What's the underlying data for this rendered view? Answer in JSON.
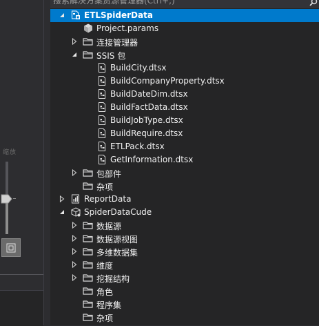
{
  "search": {
    "placeholder": "搜索解决方案资源管理器(Ctrl+;)"
  },
  "left_panel": {
    "label": "缩放"
  },
  "tree": {
    "items": [
      {
        "label": "ETLSpiderData",
        "icon": "ssis-project-icon",
        "expanded": true,
        "level": 0,
        "selected": true
      },
      {
        "label": "Project.params",
        "icon": "params-icon",
        "level": 1
      },
      {
        "label": "连接管理器",
        "icon": "folder-icon",
        "expanded": false,
        "level": 1
      },
      {
        "label": "SSIS 包",
        "icon": "folder-icon",
        "expanded": true,
        "level": 1
      },
      {
        "label": "BuildCity.dtsx",
        "icon": "package-file-icon",
        "level": 2
      },
      {
        "label": "BuildCompanyProperty.dtsx",
        "icon": "package-file-icon",
        "level": 2
      },
      {
        "label": "BuildDateDim.dtsx",
        "icon": "package-file-icon",
        "level": 2
      },
      {
        "label": "BuildFactData.dtsx",
        "icon": "package-file-icon",
        "level": 2
      },
      {
        "label": "BuildJobType.dtsx",
        "icon": "package-file-icon",
        "level": 2
      },
      {
        "label": "BuildRequire.dtsx",
        "icon": "package-file-icon",
        "level": 2
      },
      {
        "label": "ETLPack.dtsx",
        "icon": "package-file-icon",
        "level": 2
      },
      {
        "label": "GetInformation.dtsx",
        "icon": "package-file-icon",
        "level": 2
      },
      {
        "label": "包部件",
        "icon": "folder-icon",
        "expanded": false,
        "level": 1
      },
      {
        "label": "杂项",
        "icon": "folder-icon",
        "level": 1
      },
      {
        "label": "ReportData",
        "icon": "report-project-icon",
        "expanded": false,
        "level": 0
      },
      {
        "label": "SpiderDataCude",
        "icon": "analysis-project-icon",
        "expanded": true,
        "level": 0
      },
      {
        "label": "数据源",
        "icon": "folder-icon",
        "expanded": false,
        "level": 1
      },
      {
        "label": "数据源视图",
        "icon": "folder-icon",
        "expanded": false,
        "level": 1
      },
      {
        "label": "多维数据集",
        "icon": "folder-icon",
        "expanded": false,
        "level": 1
      },
      {
        "label": "维度",
        "icon": "folder-icon",
        "expanded": false,
        "level": 1
      },
      {
        "label": "挖掘结构",
        "icon": "folder-icon",
        "expanded": false,
        "level": 1
      },
      {
        "label": "角色",
        "icon": "folder-icon",
        "level": 1
      },
      {
        "label": "程序集",
        "icon": "folder-icon",
        "level": 1
      },
      {
        "label": "杂项",
        "icon": "folder-icon",
        "level": 1
      }
    ]
  },
  "colors": {
    "selection": "#007acc",
    "background": "#252526",
    "text": "#f1f1f1"
  }
}
